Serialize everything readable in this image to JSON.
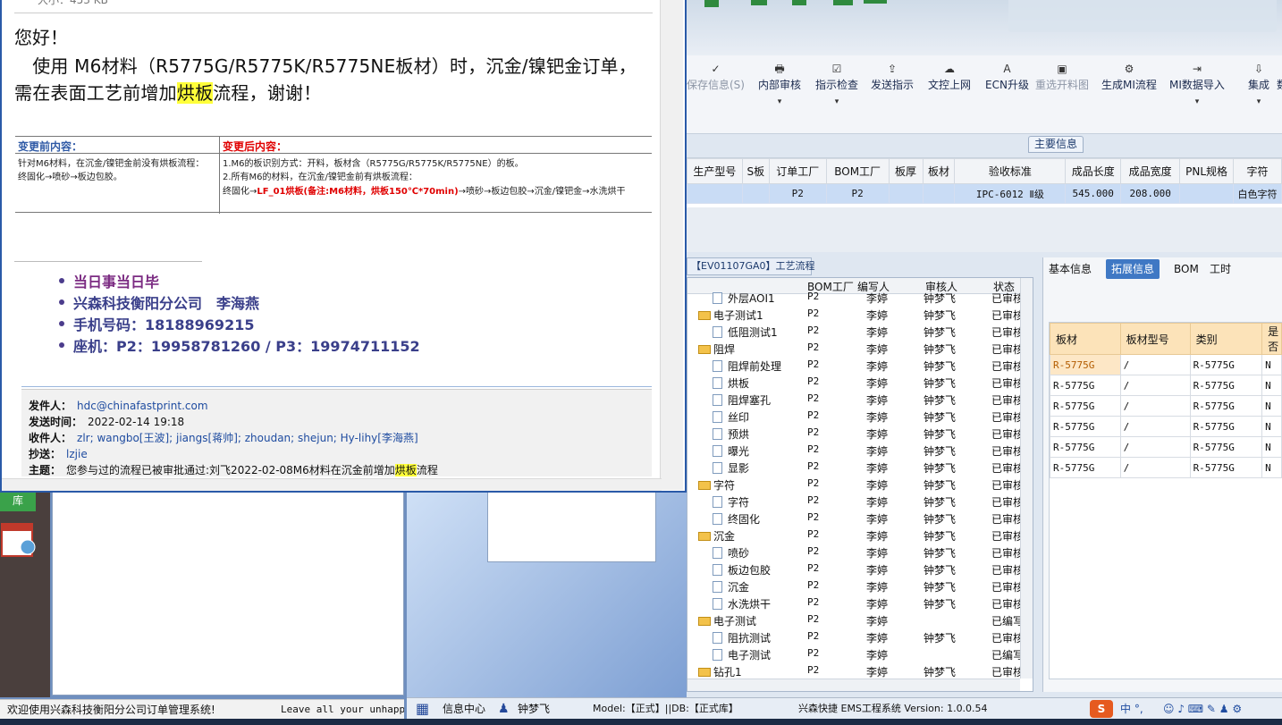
{
  "mail": {
    "size_text": "大小：453 KB",
    "greeting": "您好！",
    "line1": "　使用 M6材料（R5775G/R5775K/R5775NE板材）时，沉金/镍钯金订单，",
    "line2_pre": "需在表面工艺前增加",
    "line2_hl": "烘板",
    "line2_post": "流程，谢谢！",
    "change_table": {
      "before_header": "变更前内容：",
      "after_header": "变更后内容：",
      "before_1": "针对M6材料，在沉金/镍钯金前没有烘板流程：",
      "before_2": "终固化→喷砂→板边包胶。",
      "after_1": "1.M6的板识别方式：开料，板材含（R5775G/R5775K/R5775NE）的板。",
      "after_2": "2.所有M6的材料，在沉金/镍钯金前有烘板流程：",
      "after_3_pre": "终固化→",
      "after_3_red": "LF_01烘板(备注:M6材料，烘板150℃*70min)",
      "after_3_post": "→喷砂→板边包胶→沉金/镍钯金→水洗烘干"
    },
    "signature": {
      "line1": "当日事当日毕",
      "line2": "兴森科技衡阳分公司　李海燕",
      "line3": "手机号码：18188969215",
      "line4": "座机：P2：19958781260 / P3：19974711152"
    },
    "meta": {
      "from_label": "发件人：",
      "from": "hdc@chinafastprint.com",
      "time_label": "发送时间：",
      "time": "2022-02-14 19:18",
      "to_label": "收件人：",
      "to": "zlr; wangbo[王波]; jiangs[蒋帅]; zhoudan; shejun; Hy-lihy[李海燕]",
      "cc_label": "抄送：",
      "cc": "lzjie",
      "subject_label": "主题：",
      "subject_pre": "您参与过的流程已被审批通过:刘飞2022-02-08M6材料在沉金前增加",
      "subject_hl": "烘板",
      "subject_post": "流程"
    }
  },
  "toolbar": {
    "items": [
      {
        "icon": "✓",
        "label": "保存信息(S)",
        "dd": ""
      },
      {
        "icon": "🖶",
        "label": "内部审核",
        "dd": "▾"
      },
      {
        "icon": "☑",
        "label": "指示检查",
        "dd": "▾"
      },
      {
        "icon": "⇪",
        "label": "发送指示",
        "dd": ""
      },
      {
        "icon": "☁",
        "label": "文控上网",
        "dd": ""
      },
      {
        "icon": "A",
        "label": "ECN升级",
        "dd": ""
      },
      {
        "icon": "▣",
        "label": "重选开料图",
        "dd": ""
      },
      {
        "icon": "⚙",
        "label": "生成MI流程",
        "dd": ""
      },
      {
        "icon": "⇥",
        "label": "MI数据导入",
        "dd": "▾"
      },
      {
        "icon": "⇩",
        "label": "集成",
        "dd": "▾"
      },
      {
        "icon": "",
        "label": "数",
        "dd": ""
      }
    ]
  },
  "main_info": {
    "tab": "主要信息",
    "headers": [
      "生产型号",
      "S板",
      "订单工厂",
      "BOM工厂",
      "板厚",
      "板材",
      "验收标准",
      "成品长度",
      "成品宽度",
      "PNL规格",
      "字符"
    ],
    "row": [
      "",
      "",
      "P2",
      "P2",
      "",
      "",
      "IPC-6012 Ⅱ级",
      "545.000",
      "208.000",
      "",
      "白色字符"
    ]
  },
  "process": {
    "tab": "【EV01107GA0】工艺流程",
    "headers": [
      "BOM工厂",
      "编写人",
      "审核人",
      "状态"
    ],
    "rows": [
      {
        "type": "doc",
        "name": "外层AOI1",
        "bom": "P2",
        "writer": "李婷",
        "auditor": "钟梦飞",
        "status": "已审核"
      },
      {
        "type": "folder",
        "name": "电子测试1",
        "bom": "P2",
        "writer": "李婷",
        "auditor": "钟梦飞",
        "status": "已审核"
      },
      {
        "type": "doc",
        "name": "低阻测试1",
        "bom": "P2",
        "writer": "李婷",
        "auditor": "钟梦飞",
        "status": "已审核"
      },
      {
        "type": "folder",
        "name": "阻焊",
        "bom": "P2",
        "writer": "李婷",
        "auditor": "钟梦飞",
        "status": "已审核"
      },
      {
        "type": "doc",
        "name": "阻焊前处理",
        "bom": "P2",
        "writer": "李婷",
        "auditor": "钟梦飞",
        "status": "已审核"
      },
      {
        "type": "doc",
        "name": "烘板",
        "bom": "P2",
        "writer": "李婷",
        "auditor": "钟梦飞",
        "status": "已审核"
      },
      {
        "type": "doc",
        "name": "阻焊塞孔",
        "bom": "P2",
        "writer": "李婷",
        "auditor": "钟梦飞",
        "status": "已审核"
      },
      {
        "type": "doc",
        "name": "丝印",
        "bom": "P2",
        "writer": "李婷",
        "auditor": "钟梦飞",
        "status": "已审核"
      },
      {
        "type": "doc",
        "name": "预烘",
        "bom": "P2",
        "writer": "李婷",
        "auditor": "钟梦飞",
        "status": "已审核"
      },
      {
        "type": "doc",
        "name": "曝光",
        "bom": "P2",
        "writer": "李婷",
        "auditor": "钟梦飞",
        "status": "已审核"
      },
      {
        "type": "doc",
        "name": "显影",
        "bom": "P2",
        "writer": "李婷",
        "auditor": "钟梦飞",
        "status": "已审核"
      },
      {
        "type": "folder",
        "name": "字符",
        "bom": "P2",
        "writer": "李婷",
        "auditor": "钟梦飞",
        "status": "已审核"
      },
      {
        "type": "doc",
        "name": "字符",
        "bom": "P2",
        "writer": "李婷",
        "auditor": "钟梦飞",
        "status": "已审核"
      },
      {
        "type": "doc",
        "name": "终固化",
        "bom": "P2",
        "writer": "李婷",
        "auditor": "钟梦飞",
        "status": "已审核"
      },
      {
        "type": "folder",
        "name": "沉金",
        "bom": "P2",
        "writer": "李婷",
        "auditor": "钟梦飞",
        "status": "已审核"
      },
      {
        "type": "doc",
        "name": "喷砂",
        "bom": "P2",
        "writer": "李婷",
        "auditor": "钟梦飞",
        "status": "已审核"
      },
      {
        "type": "doc",
        "name": "板边包胶",
        "bom": "P2",
        "writer": "李婷",
        "auditor": "钟梦飞",
        "status": "已审核"
      },
      {
        "type": "doc",
        "name": "沉金",
        "bom": "P2",
        "writer": "李婷",
        "auditor": "钟梦飞",
        "status": "已审核"
      },
      {
        "type": "doc",
        "name": "水洗烘干",
        "bom": "P2",
        "writer": "李婷",
        "auditor": "钟梦飞",
        "status": "已审核"
      },
      {
        "type": "folder",
        "name": "电子测试",
        "bom": "P2",
        "writer": "李婷",
        "auditor": "",
        "status": "已编写"
      },
      {
        "type": "doc",
        "name": "阻抗测试",
        "bom": "P2",
        "writer": "李婷",
        "auditor": "钟梦飞",
        "status": "已审核"
      },
      {
        "type": "doc",
        "name": "电子测试",
        "bom": "P2",
        "writer": "李婷",
        "auditor": "",
        "status": "已编写"
      },
      {
        "type": "folder",
        "name": "钻孔1",
        "bom": "P2",
        "writer": "李婷",
        "auditor": "钟梦飞",
        "status": "已审核"
      }
    ]
  },
  "right_panel": {
    "tabs": [
      "基本信息",
      "拓展信息",
      "BOM",
      "工时"
    ],
    "headers": [
      "板材",
      "板材型号",
      "类别",
      "是否"
    ],
    "rows": [
      [
        "R-5775G",
        "/",
        "R-5775G",
        "N"
      ],
      [
        "R-5775G",
        "/",
        "R-5775G",
        "N"
      ],
      [
        "R-5775G",
        "/",
        "R-5775G",
        "N"
      ],
      [
        "R-5775G",
        "/",
        "R-5775G",
        "N"
      ],
      [
        "R-5775G",
        "/",
        "R-5775G",
        "N"
      ],
      [
        "R-5775G",
        "/",
        "R-5775G",
        "N"
      ]
    ]
  },
  "left_misc": {
    "ku_label": "库"
  },
  "status": {
    "left_msg": "欢迎使用兴森科技衡阳分公司订单管理系统!",
    "left_scroll": "Leave all your unhappiness",
    "info_center": "信息中心",
    "user": "钟梦飞",
    "model": "Model:【正式】||DB:【正式库】",
    "system": "兴森快捷 EMS工程系统 Version: 1.0.0.54",
    "ime": "中 °,"
  }
}
